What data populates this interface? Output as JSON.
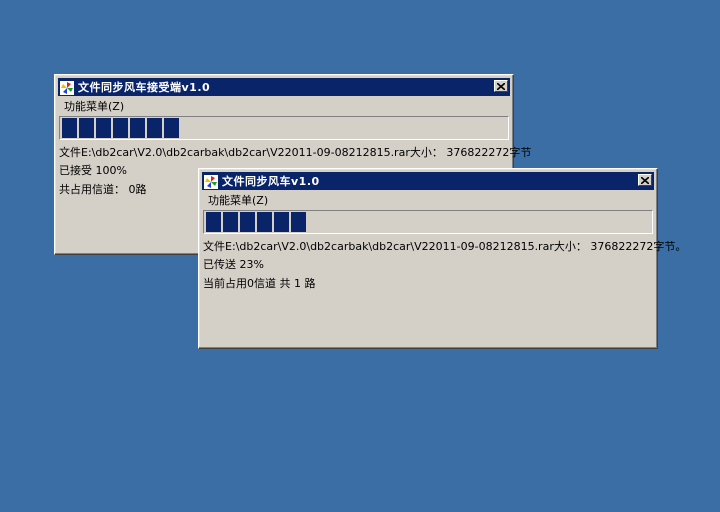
{
  "colors": {
    "desktop": "#3a6ea5",
    "titlebar": "#0a246a",
    "window": "#d4d0c8",
    "progress_block": "#0a246a"
  },
  "receiver": {
    "title": "文件同步风车接受端v1.0",
    "menu": "功能菜单(Z)",
    "progress_percent": 26,
    "file_line": "文件E:\\db2car\\V2.0\\db2carbak\\db2car\\V22011-09-08212815.rar大小： 376822272字节",
    "status_line": "已接受 100%",
    "channel_line": "共占用信道：  0路",
    "icon": "app-windmill-icon",
    "close_icon": "close-icon"
  },
  "sender": {
    "title": "文件同步风车v1.0",
    "menu": "功能菜单(Z)",
    "progress_percent": 23,
    "file_line": "文件E:\\db2car\\V2.0\\db2carbak\\db2car\\V22011-09-08212815.rar大小： 376822272字节。",
    "status_line": "已传送 23%",
    "channel_line": "当前占用0信道 共 1 路",
    "icon": "app-windmill-icon",
    "close_icon": "close-icon"
  }
}
